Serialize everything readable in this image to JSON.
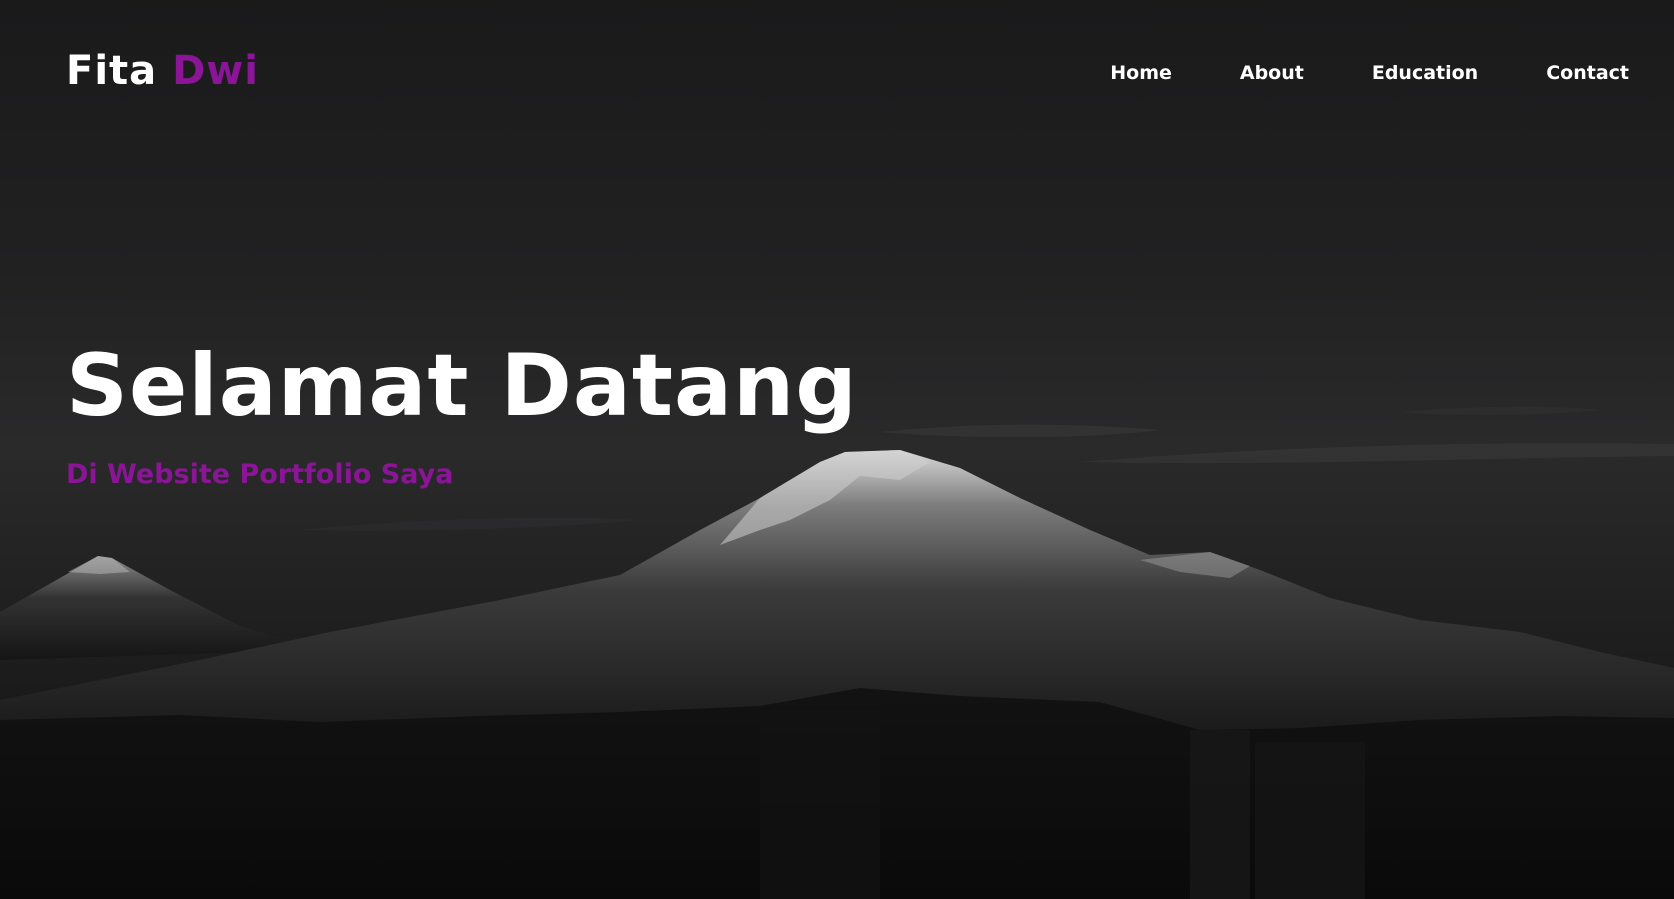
{
  "brand": {
    "first": "Fita",
    "second": "Dwi"
  },
  "nav": {
    "items": [
      {
        "label": "Home"
      },
      {
        "label": "About"
      },
      {
        "label": "Education"
      },
      {
        "label": "Contact"
      }
    ]
  },
  "hero": {
    "title": "Selamat Datang",
    "subtitle": "Di Website Portfolio Saya",
    "background": "black-and-white mountain photo"
  },
  "colors": {
    "accent": "#8a1596",
    "text": "#ffffff",
    "background": "#1c1c1c"
  }
}
